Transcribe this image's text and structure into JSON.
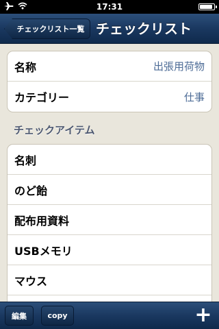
{
  "statusbar": {
    "time": "17:31",
    "battery_level": 0.9
  },
  "navbar": {
    "back_label": "チェックリスト一覧",
    "title": "チェックリスト"
  },
  "details": [
    {
      "label": "名称",
      "value": "出張用荷物"
    },
    {
      "label": "カテゴリー",
      "value": "仕事"
    }
  ],
  "section_header": "チェックアイテム",
  "items": [
    {
      "label": "名刺"
    },
    {
      "label": "のど飴"
    },
    {
      "label": "配布用資料"
    },
    {
      "label": "USBメモリ"
    },
    {
      "label": "マウス"
    }
  ],
  "toolbar": {
    "edit_label": "編集",
    "copy_label": "copy",
    "add_label": "+"
  }
}
